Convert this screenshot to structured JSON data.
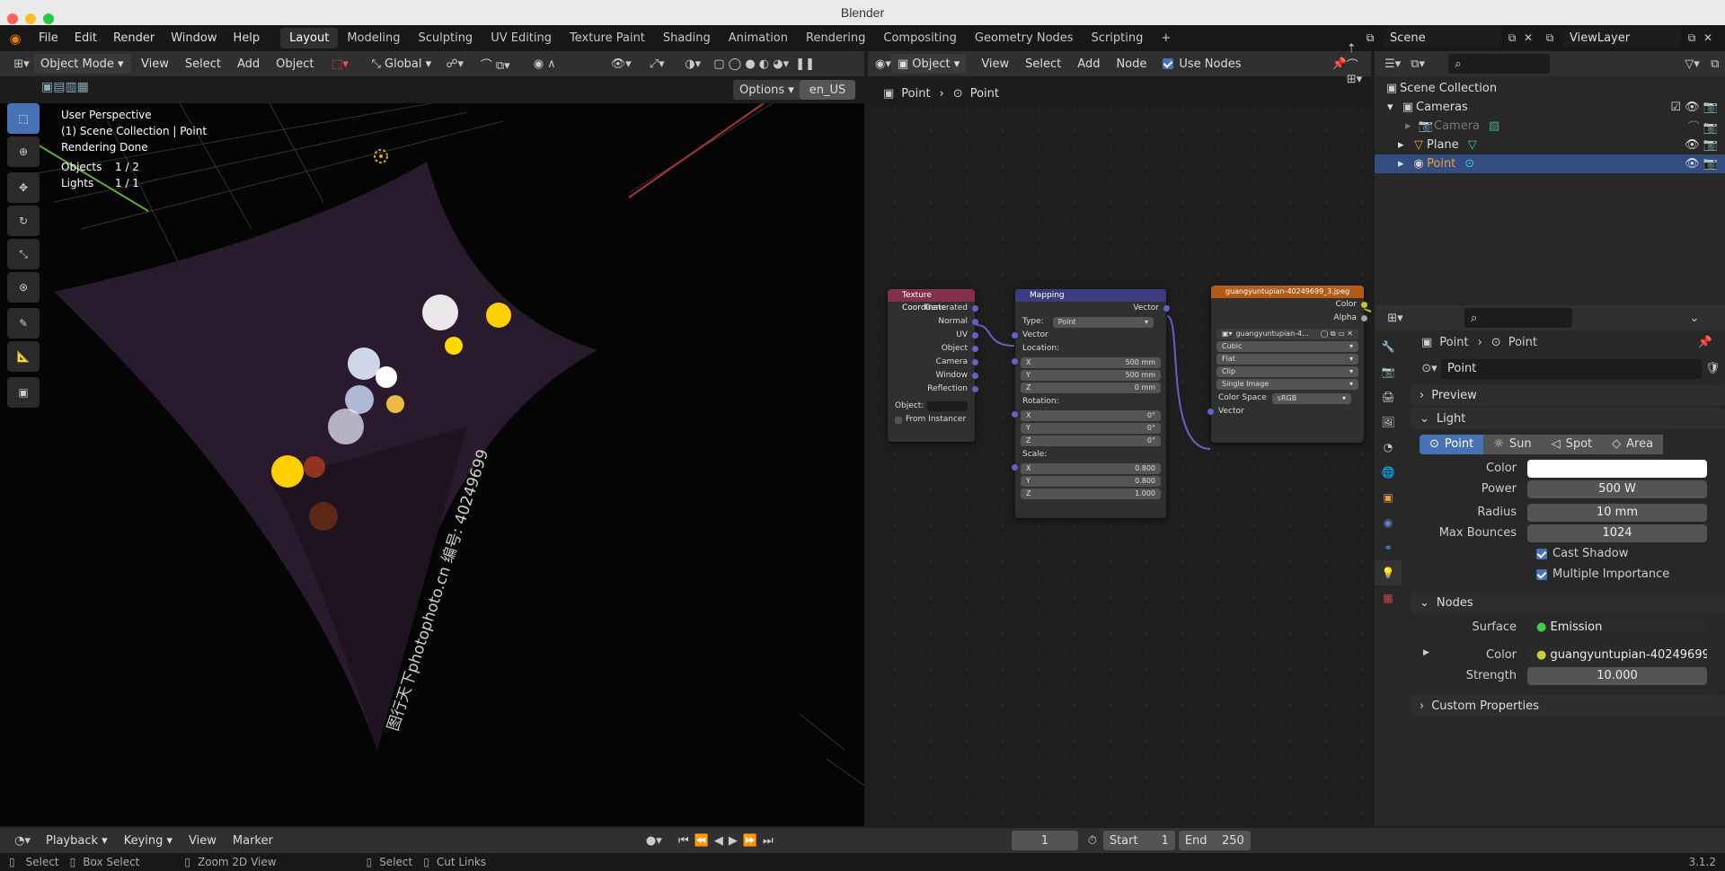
{
  "app": {
    "title": "Blender",
    "version": "3.1.2"
  },
  "menu": [
    "File",
    "Edit",
    "Render",
    "Window",
    "Help"
  ],
  "workspaces": [
    {
      "label": "Layout",
      "active": true
    },
    {
      "label": "Modeling"
    },
    {
      "label": "Sculpting"
    },
    {
      "label": "UV Editing"
    },
    {
      "label": "Texture Paint"
    },
    {
      "label": "Shading"
    },
    {
      "label": "Animation"
    },
    {
      "label": "Rendering"
    },
    {
      "label": "Compositing"
    },
    {
      "label": "Geometry Nodes"
    },
    {
      "label": "Scripting"
    }
  ],
  "scene": {
    "name": "Scene",
    "view_layer": "ViewLayer"
  },
  "viewport": {
    "mode": "Object Mode",
    "menus": [
      "View",
      "Select",
      "Add",
      "Object"
    ],
    "orientation": "Global",
    "options": "Options",
    "language": "en_US",
    "overlay": {
      "line1": "User Perspective",
      "line2": "(1) Scene Collection | Point",
      "line3": "Rendering Done",
      "objects_label": "Objects",
      "objects_value": "1 / 2",
      "lights_label": "Lights",
      "lights_value": "1 / 1"
    },
    "plane_text": "图行天下photophoto.cn 编号: 40249699"
  },
  "node_editor": {
    "type": "Object",
    "menus": [
      "View",
      "Select",
      "Add",
      "Node"
    ],
    "use_nodes": "Use Nodes",
    "breadcrumb": [
      "Point",
      "Point"
    ],
    "tex_coord": {
      "title": "Texture Coordinate",
      "outputs": [
        "Generated",
        "Normal",
        "UV",
        "Object",
        "Camera",
        "Window",
        "Reflection"
      ],
      "object_label": "Object:",
      "from_instancer": "From Instancer"
    },
    "mapping": {
      "title": "Mapping",
      "output": "Vector",
      "type_label": "Type:",
      "type_value": "Point",
      "vector": "Vector",
      "location_label": "Location:",
      "location": [
        {
          "axis": "X",
          "value": "500 mm"
        },
        {
          "axis": "Y",
          "value": "500 mm"
        },
        {
          "axis": "Z",
          "value": "0 mm"
        }
      ],
      "rotation_label": "Rotation:",
      "rotation": [
        {
          "axis": "X",
          "value": "0°"
        },
        {
          "axis": "Y",
          "value": "0°"
        },
        {
          "axis": "Z",
          "value": "0°"
        }
      ],
      "scale_label": "Scale:",
      "scale": [
        {
          "axis": "X",
          "value": "0.800"
        },
        {
          "axis": "Y",
          "value": "0.800"
        },
        {
          "axis": "Z",
          "value": "1.000"
        }
      ]
    },
    "image_tex": {
      "title": "guangyuntupian-40249699_3.jpeg",
      "outputs": [
        "Color",
        "Alpha"
      ],
      "image_name": "guangyuntupian-4...",
      "interpolation": "Cubic",
      "projection": "Flat",
      "extension": "Clip",
      "source": "Single Image",
      "color_space_label": "Color Space",
      "color_space": "sRGB",
      "input": "Vector"
    }
  },
  "outliner": {
    "root": "Scene Collection",
    "items": [
      {
        "label": "Cameras",
        "indent": 1
      },
      {
        "label": "Camera",
        "indent": 2,
        "dim": true
      },
      {
        "label": "Plane",
        "indent": 1
      },
      {
        "label": "Point",
        "indent": 1,
        "selected": true
      }
    ]
  },
  "properties": {
    "breadcrumb": [
      "Point",
      "Point"
    ],
    "datablock": "Point",
    "preview": "Preview",
    "light_panel": "Light",
    "light_types": [
      "Point",
      "Sun",
      "Spot",
      "Area"
    ],
    "color_label": "Color",
    "color_value": "#ffffff",
    "power_label": "Power",
    "power": "500 W",
    "radius_label": "Radius",
    "radius": "10 mm",
    "max_bounces_label": "Max Bounces",
    "max_bounces": "1024",
    "cast_shadow": "Cast Shadow",
    "multiple_importance": "Multiple Importance",
    "nodes_panel": "Nodes",
    "surface_label": "Surface",
    "surface": "Emission",
    "node_color_label": "Color",
    "node_color": "guangyuntupian-40249699...",
    "strength_label": "Strength",
    "strength": "10.000",
    "custom_props": "Custom Properties"
  },
  "timeline": {
    "playback": "Playback",
    "keying": "Keying",
    "view": "View",
    "marker": "Marker",
    "current_frame": "1",
    "start_label": "Start",
    "start": "1",
    "end_label": "End",
    "end": "250"
  },
  "status": {
    "select": "Select",
    "box_select": "Box Select",
    "zoom": "Zoom 2D View",
    "select2": "Select",
    "cut_links": "Cut Links"
  },
  "colors": {
    "accent": "#4772b3",
    "tex_coord_header": "#83314a",
    "mapping_header": "#3c3c83",
    "image_header": "#b35c17",
    "link": "#6363c7"
  }
}
